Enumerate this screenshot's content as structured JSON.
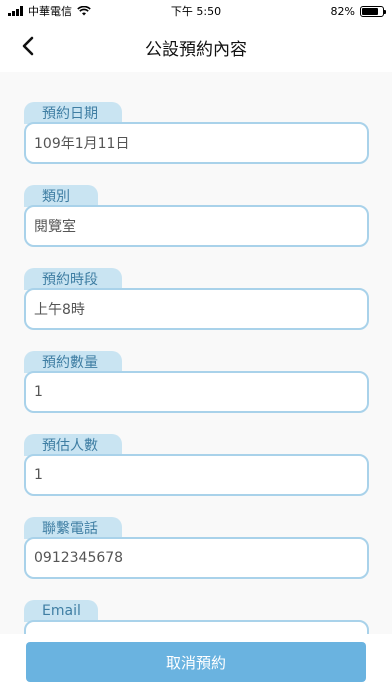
{
  "status_bar": {
    "carrier": "中華電信",
    "time": "下午 5:50",
    "battery": "82%",
    "battery_level": 0.82
  },
  "nav": {
    "title": "公設預約內容",
    "back_icon": "chevron-left-icon"
  },
  "fields": [
    {
      "label": "預約日期",
      "value": "109年1月11日"
    },
    {
      "label": "類別",
      "value": "閱覽室"
    },
    {
      "label": "預約時段",
      "value": "上午8時"
    },
    {
      "label": "預約數量",
      "value": "1"
    },
    {
      "label": "預估人數",
      "value": "1"
    },
    {
      "label": "聯繫電話",
      "value": "0912345678"
    },
    {
      "label": "Email",
      "value": ""
    }
  ],
  "actions": {
    "cancel_label": "取消預約"
  },
  "colors": {
    "tag_bg": "#c9e4f2",
    "tag_text": "#3f7ea3",
    "border": "#a9d2ea",
    "button": "#6ab3e0"
  }
}
